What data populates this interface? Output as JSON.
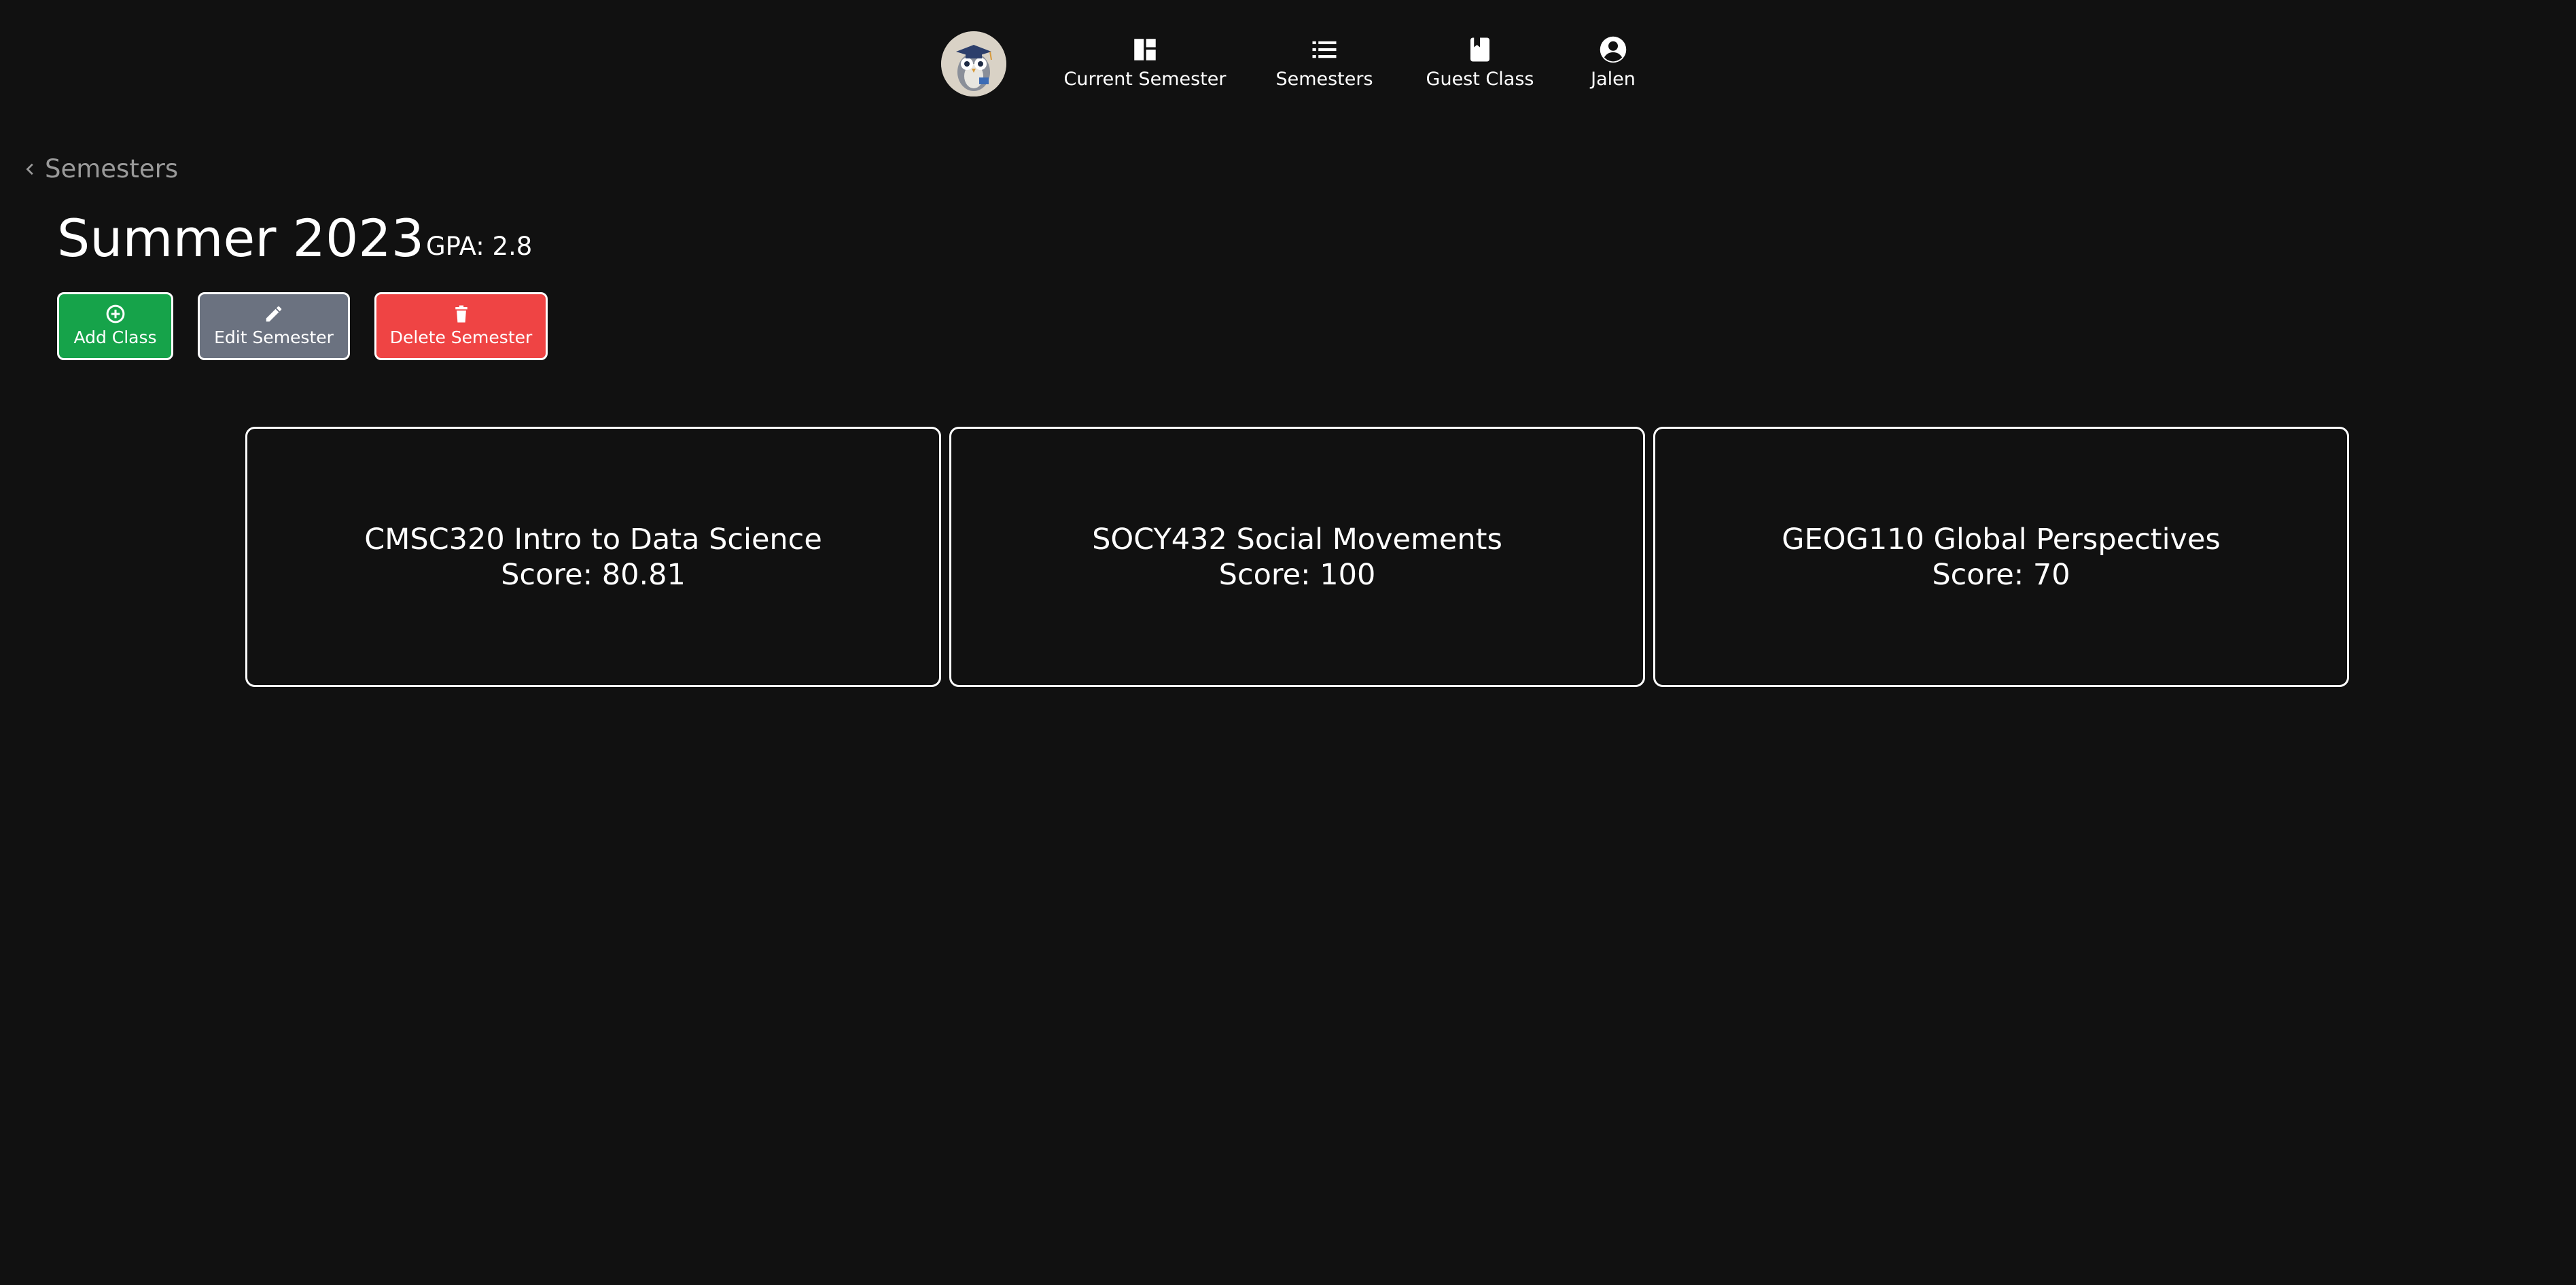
{
  "nav": {
    "logo_icon": "owl-graduate-logo",
    "items": [
      {
        "label": "Current Semester",
        "icon": "dashboard-icon"
      },
      {
        "label": "Semesters",
        "icon": "list-icon"
      },
      {
        "label": "Guest Class",
        "icon": "book-icon"
      },
      {
        "label": "Jalen",
        "icon": "account-circle-icon"
      }
    ]
  },
  "breadcrumb": {
    "label": "Semesters",
    "icon": "chevron-left-icon"
  },
  "semester": {
    "title": "Summer 2023",
    "gpa": "GPA: 2.8"
  },
  "actions": {
    "add_label": "Add Class",
    "edit_label": "Edit Semester",
    "delete_label": "Delete Semester",
    "add_color": "#16a34a",
    "edit_color": "#6b7280",
    "delete_color": "#ef4444"
  },
  "classes": [
    {
      "title": "CMSC320 Intro to Data Science",
      "score": "Score: 80.81"
    },
    {
      "title": "SOCY432 Social Movements",
      "score": "Score: 100"
    },
    {
      "title": "GEOG110 Global Perspectives",
      "score": "Score: 70"
    }
  ],
  "colors": {
    "background": "#111111",
    "text": "#ffffff",
    "muted_text": "#9a9a9a"
  }
}
